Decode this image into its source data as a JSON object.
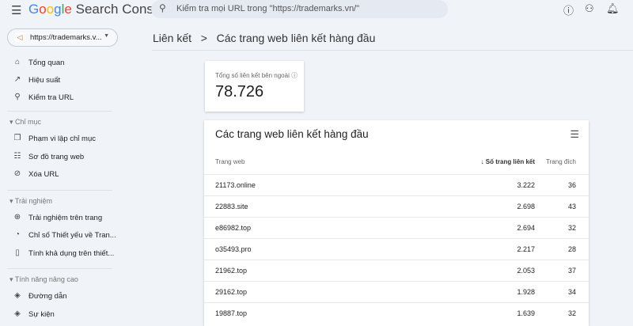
{
  "header": {
    "app_title": "Google Search Console",
    "search_placeholder": "Kiểm tra mọi URL trong \"https://trademarks.vn/\""
  },
  "property": "https://trademarks.v...",
  "nav": [
    {
      "icon": "home-icon",
      "glyph": "⌂",
      "label": "Tổng quan"
    },
    {
      "icon": "trending-icon",
      "glyph": "↗",
      "label": "Hiệu suất"
    },
    {
      "icon": "search-icon",
      "glyph": "⚲",
      "label": "Kiểm tra URL"
    }
  ],
  "sections": [
    {
      "title": "Chỉ mục",
      "items": [
        {
          "icon": "pages-icon",
          "glyph": "❐",
          "label": "Phạm vi lập chỉ mục"
        },
        {
          "icon": "sitemap-icon",
          "glyph": "☷",
          "label": "Sơ đồ trang web"
        },
        {
          "icon": "visibility-off-icon",
          "glyph": "⊘",
          "label": "Xóa URL"
        }
      ]
    },
    {
      "title": "Trải nghiệm",
      "items": [
        {
          "icon": "add-circle-icon",
          "glyph": "⊕",
          "label": "Trải nghiệm trên trang"
        },
        {
          "icon": "speed-icon",
          "glyph": "◔",
          "label": "Chỉ số Thiết yếu về Tran..."
        },
        {
          "icon": "phone-icon",
          "glyph": "▯",
          "label": "Tính khả dụng trên thiết..."
        }
      ]
    },
    {
      "title": "Tính năng nâng cao",
      "items": [
        {
          "icon": "layers-icon",
          "glyph": "◈",
          "label": "Đường dẫn"
        },
        {
          "icon": "layers-icon",
          "glyph": "◈",
          "label": "Sự kiện"
        }
      ]
    }
  ],
  "breadcrumb": {
    "parent": "Liên kết",
    "sep": ">",
    "current": "Các trang web liên kết hàng đầu"
  },
  "kpi": {
    "label": "Tổng số liên kết bên ngoài",
    "value": "78.726"
  },
  "table": {
    "title": "Các trang web liên kết hàng đầu",
    "columns": [
      "Trang web",
      "Số trang liên kết",
      "Trang đích"
    ],
    "rows": [
      [
        "21173.online",
        "3.222",
        "36"
      ],
      [
        "22883.site",
        "2.698",
        "43"
      ],
      [
        "e86982.top",
        "2.694",
        "32"
      ],
      [
        "o35493.pro",
        "2.217",
        "28"
      ],
      [
        "21962.top",
        "2.053",
        "37"
      ],
      [
        "29162.top",
        "1.928",
        "34"
      ],
      [
        "19887.top",
        "1.639",
        "32"
      ]
    ]
  }
}
